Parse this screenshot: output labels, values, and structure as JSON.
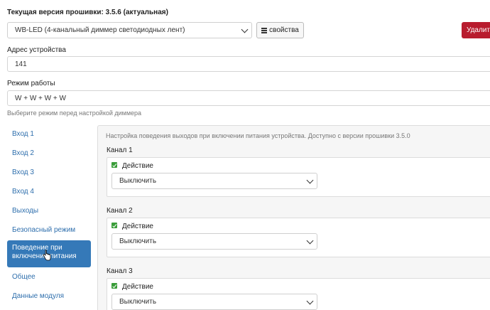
{
  "firmware": {
    "line": "Текущая версия прошивки: 3.5.6 (актуальная)"
  },
  "device": {
    "selected": "WB-LED (4-канальный диммер светодиодных лент)",
    "props_label": "свойства",
    "delete_label": "Удалить"
  },
  "address": {
    "label": "Адрес устройства",
    "value": "141"
  },
  "mode": {
    "label": "Режим работы",
    "value": "W + W + W + W",
    "hint": "Выберите режим перед настройкой диммера"
  },
  "nav": {
    "items": [
      "Вход 1",
      "Вход 2",
      "Вход 3",
      "Вход 4",
      "Выходы",
      "Безопасный режим"
    ],
    "active_line1": "Поведение при",
    "active_line2": "включении питания",
    "after": [
      "Общее",
      "Данные модуля"
    ]
  },
  "panel": {
    "note": "Настройка поведения выходов при включении питания устройства. Доступно с версии прошивки 3.5.0",
    "channels": [
      {
        "title": "Канал 1",
        "checkbox_label": "Действие",
        "checked": true,
        "select": "Выключить"
      },
      {
        "title": "Канал 2",
        "checkbox_label": "Действие",
        "checked": true,
        "select": "Выключить"
      },
      {
        "title": "Канал 3",
        "checkbox_label": "Действие",
        "checked": true,
        "select": "Выключить"
      }
    ]
  },
  "colors": {
    "accent": "#3579b8",
    "danger": "#b81c2e",
    "check": "#3a9d3a",
    "link": "#2f6fad"
  }
}
